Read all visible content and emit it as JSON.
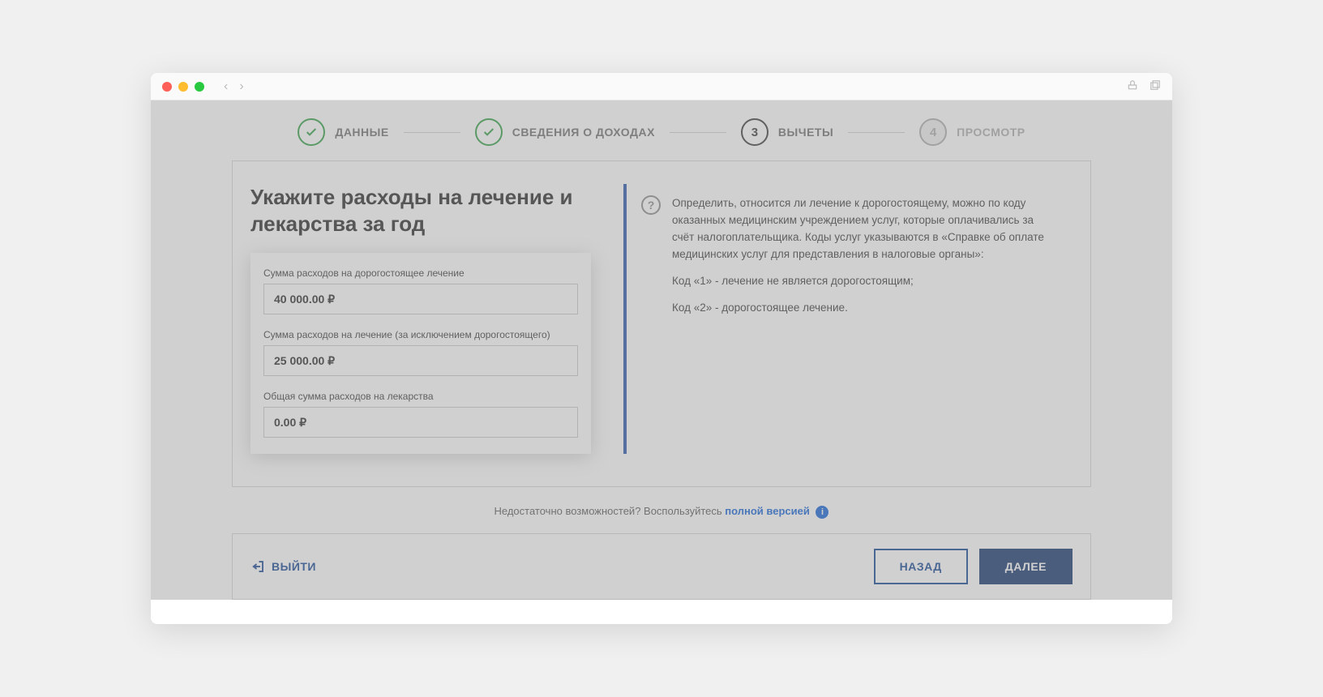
{
  "stepper": {
    "steps": [
      {
        "label": "ДАННЫЕ",
        "state": "done"
      },
      {
        "label": "СВЕДЕНИЯ О ДОХОДАХ",
        "state": "done"
      },
      {
        "label": "ВЫЧЕТЫ",
        "state": "current",
        "number": "3"
      },
      {
        "label": "ПРОСМОТР",
        "state": "future",
        "number": "4"
      }
    ]
  },
  "heading": "Укажите расходы на лечение и лекарства за год",
  "form": {
    "fields": [
      {
        "label": "Сумма расходов на дорогостоящее лечение",
        "value": "40 000.00 ₽"
      },
      {
        "label": "Сумма расходов на лечение (за исключением дорогостоящего)",
        "value": "25 000.00 ₽"
      },
      {
        "label": "Общая сумма расходов на лекарства",
        "value": "0.00 ₽"
      }
    ]
  },
  "info": {
    "p1": "Определить, относится ли лечение к дорогостоящему, можно по коду оказанных медицинским учреждением услуг, которые оплачивались за счёт налогоплательщика. Коды услуг указываются в «Справке об оплате медицинских услуг для представления в налоговые органы»:",
    "p2": "Код «1» - лечение не является дорогостоящим;",
    "p3": "Код «2» - дорогостоящее лечение."
  },
  "helper": {
    "text": "Недостаточно возможностей? Воспользуйтесь ",
    "link": "полной версией"
  },
  "actions": {
    "exit": "ВЫЙТИ",
    "back": "НАЗАД",
    "next": "ДАЛЕЕ"
  }
}
